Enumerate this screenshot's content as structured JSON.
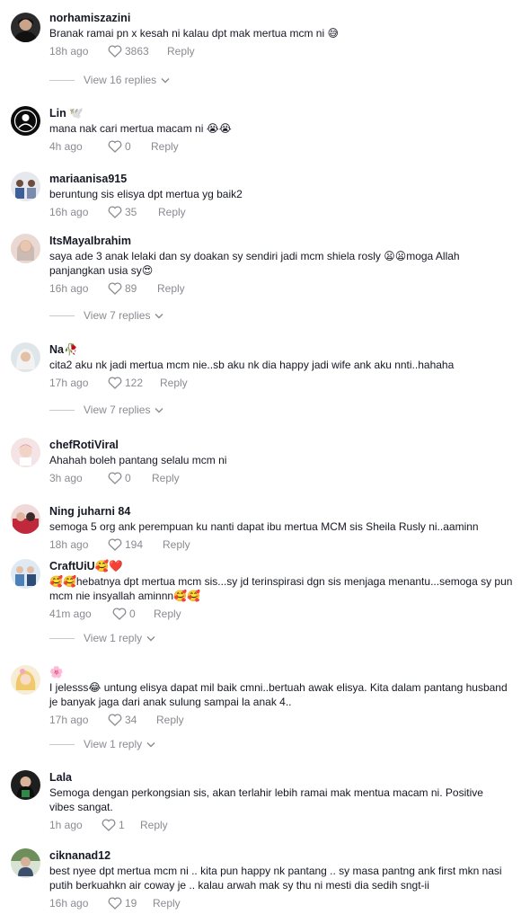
{
  "comments": [
    {
      "username": "norhamiszazini",
      "text": "Branak ramai pn x kesah ni kalau dpt mak mertua mcm ni 😅",
      "time": "18h ago",
      "likes": "3863",
      "reply": "Reply",
      "view_replies": "View 16 replies"
    },
    {
      "username": "Lin 🕊️",
      "text": "mana nak cari mertua macam ni 😭😭",
      "time": "4h ago",
      "likes": "0",
      "reply": "Reply"
    },
    {
      "username": "mariaanisa915",
      "text": "beruntung sis elisya dpt mertua yg baik2",
      "time": "16h ago",
      "likes": "35",
      "reply": "Reply"
    },
    {
      "username": "ItsMayaIbrahim",
      "text": "saya ade 3 anak lelaki dan sy doakan sy sendiri jadi mcm shiela rosly 😦😦moga Allah panjangkan usia sy😍",
      "time": "16h ago",
      "likes": "89",
      "reply": "Reply",
      "view_replies": "View 7 replies"
    },
    {
      "username": "Na🥀",
      "text": "cita2 aku nk jadi mertua mcm nie..sb aku nk dia happy jadi wife ank aku nnti..hahaha",
      "time": "17h ago",
      "likes": "122",
      "reply": "Reply",
      "view_replies": "View 7 replies"
    },
    {
      "username": "chefRotiViral",
      "text": "Ahahah boleh pantang selalu mcm ni",
      "time": "3h ago",
      "likes": "0",
      "reply": "Reply"
    },
    {
      "username": "Ning juharni 84",
      "text": "semoga 5 org ank perempuan ku nanti dapat ibu mertua MCM sis Sheila Rusly ni..aaminn",
      "time": "18h ago",
      "likes": "194",
      "reply": "Reply"
    },
    {
      "username": "CraftUiU🥰❤️",
      "text": "🥰🥰hebatnya dpt mertua mcm sis...sy jd terinspirasi dgn sis menjaga menantu...semoga sy pun mcm nie insyallah aminnn🥰🥰",
      "time": "41m ago",
      "likes": "0",
      "reply": "Reply",
      "view_replies": "View 1 reply"
    },
    {
      "username": "🌸",
      "text": "I jelesss😂 untung elisya dapat mil baik cmni..bertuah awak elisya. Kita dalam pantang husband je banyak jaga dari anak sulung sampai la anak 4..",
      "time": "17h ago",
      "likes": "34",
      "reply": "Reply",
      "view_replies": "View 1 reply"
    },
    {
      "username": "Lala",
      "text": "Semoga dengan perkongsian sis, akan terlahir lebih ramai mak mentua macam ni. Positive vibes sangat.",
      "time": "1h ago",
      "likes": "1",
      "reply": "Reply"
    },
    {
      "username": "ciknanad12",
      "text": "best nyee dpt mertua mcm ni .. kita pun happy nk pantang .. sy masa pantng ank first mkn nasi putih berkuahkn air coway je .. kalau arwah mak sy thu ni mesti dia sedih sngt-ii",
      "time": "16h ago",
      "likes": "19",
      "reply": "Reply"
    }
  ],
  "colors": {
    "primary_text": "#161823",
    "secondary_text": "#8a8b91",
    "background": "#ffffff"
  },
  "icons": {
    "like": "heart-outline-icon",
    "expand": "chevron-down-icon"
  }
}
